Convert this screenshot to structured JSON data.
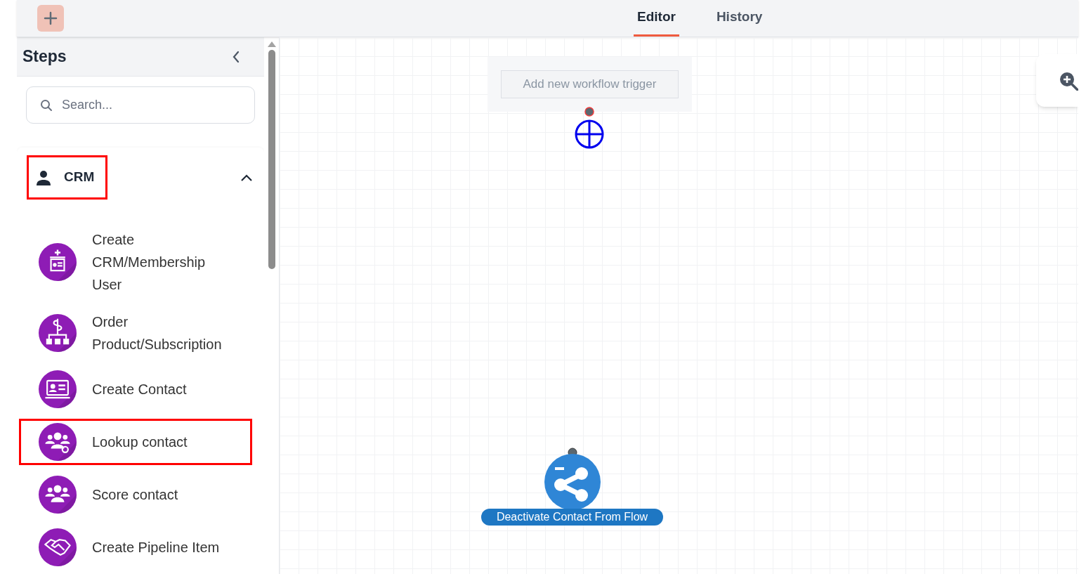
{
  "tabs": [
    {
      "label": "Editor",
      "selected": true
    },
    {
      "label": "History",
      "selected": false
    }
  ],
  "sidebar": {
    "title": "Steps",
    "search": {
      "placeholder": "Search..."
    },
    "section": {
      "label": "CRM",
      "expanded": true,
      "highlighted": true,
      "items": [
        {
          "label": "Create CRM/Membership User",
          "kind": "membership",
          "highlighted": false
        },
        {
          "label": "Order Product/Subscription",
          "kind": "order",
          "highlighted": false
        },
        {
          "label": "Create Contact",
          "kind": "contact-card",
          "highlighted": false
        },
        {
          "label": "Lookup contact",
          "kind": "lookup",
          "highlighted": true
        },
        {
          "label": "Score contact",
          "kind": "group",
          "highlighted": false
        },
        {
          "label": "Create Pipeline Item",
          "kind": "handshake",
          "highlighted": false
        }
      ]
    }
  },
  "canvas": {
    "trigger": {
      "label": "Add new workflow trigger"
    },
    "nodes": [
      {
        "label": "Deactivate Contact From Flow"
      }
    ]
  }
}
